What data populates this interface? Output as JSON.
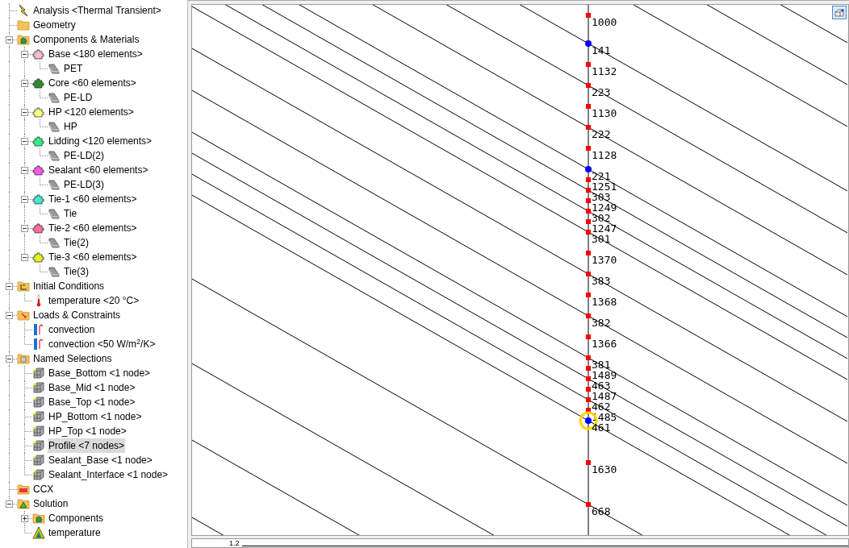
{
  "tree": [
    {
      "label": "Analysis <Thermal Transient>",
      "kind": "analysis",
      "selected": false
    },
    {
      "label": "Geometry",
      "kind": "folder",
      "selected": false
    },
    {
      "label": "Components & Materials",
      "kind": "components",
      "selected": false,
      "expanded": true,
      "children": [
        {
          "label": "Base <180 elements>",
          "kind": "part",
          "color": "#f7bccb",
          "selected": false,
          "expanded": true,
          "children": [
            {
              "label": "PET",
              "kind": "material",
              "selected": false
            }
          ]
        },
        {
          "label": "Core <60 elements>",
          "kind": "part",
          "color": "#2e8b2e",
          "selected": false,
          "expanded": true,
          "children": [
            {
              "label": "PE-LD",
              "kind": "material",
              "selected": false
            }
          ]
        },
        {
          "label": "HP <120 elements>",
          "kind": "part",
          "color": "#ffff88",
          "selected": false,
          "expanded": true,
          "children": [
            {
              "label": "HP",
              "kind": "material",
              "selected": false
            }
          ]
        },
        {
          "label": "Lidding <120 elements>",
          "kind": "part",
          "color": "#33ee88",
          "selected": false,
          "expanded": true,
          "children": [
            {
              "label": "PE-LD(2)",
              "kind": "material",
              "selected": false
            }
          ]
        },
        {
          "label": "Sealant <60 elements>",
          "kind": "part",
          "color": "#ff55ee",
          "selected": false,
          "expanded": true,
          "children": [
            {
              "label": "PE-LD(3)",
              "kind": "material",
              "selected": false
            }
          ]
        },
        {
          "label": "Tie-1 <60 elements>",
          "kind": "part",
          "color": "#44e8d0",
          "selected": false,
          "expanded": true,
          "children": [
            {
              "label": "Tie",
              "kind": "material",
              "selected": false
            }
          ]
        },
        {
          "label": "Tie-2 <60 elements>",
          "kind": "part",
          "color": "#ff6fa0",
          "selected": false,
          "expanded": true,
          "children": [
            {
              "label": "Tie(2)",
              "kind": "material",
              "selected": false
            }
          ]
        },
        {
          "label": "Tie-3 <60 elements>",
          "kind": "part",
          "color": "#e8f020",
          "selected": false,
          "expanded": true,
          "children": [
            {
              "label": "Tie(3)",
              "kind": "material",
              "selected": false
            }
          ]
        }
      ]
    },
    {
      "label": "Initial Conditions",
      "kind": "initial",
      "selected": false,
      "expanded": true,
      "children": [
        {
          "label": "temperature <20 °C>",
          "kind": "thermometer",
          "selected": false
        }
      ]
    },
    {
      "label": "Loads & Constraints",
      "kind": "loads",
      "selected": false,
      "expanded": true,
      "children": [
        {
          "label": "convection",
          "kind": "convection",
          "selected": false
        },
        {
          "label": "convection <50 W/m$^{2}$/K>",
          "kind": "convection",
          "selected": false
        }
      ]
    },
    {
      "label": "Named Selections",
      "kind": "selections",
      "selected": false,
      "expanded": true,
      "children": [
        {
          "label": "Base_Bottom <1 node>",
          "kind": "nodeset",
          "selected": false
        },
        {
          "label": "Base_Mid <1 node>",
          "kind": "nodeset",
          "selected": false
        },
        {
          "label": "Base_Top <1 node>",
          "kind": "nodeset",
          "selected": false
        },
        {
          "label": "HP_Bottom <1 node>",
          "kind": "nodeset",
          "selected": false
        },
        {
          "label": "HP_Top <1 node>",
          "kind": "nodeset",
          "selected": false
        },
        {
          "label": "Profile <7 nodes>",
          "kind": "nodeset",
          "selected": true
        },
        {
          "label": "Sealant_Base <1 node>",
          "kind": "nodeset",
          "selected": false
        },
        {
          "label": "Sealant_Interface <1 node>",
          "kind": "nodeset",
          "selected": false
        }
      ]
    },
    {
      "label": "CCX",
      "kind": "ccx",
      "selected": false
    },
    {
      "label": "Solution",
      "kind": "solution",
      "selected": false,
      "expanded": true,
      "children": [
        {
          "label": "Components",
          "kind": "components",
          "selected": false,
          "expanded": false
        },
        {
          "label": "temperature",
          "kind": "result",
          "selected": false
        }
      ]
    }
  ],
  "viewport": {
    "nodes": [
      {
        "label": "1000",
        "kind": "square",
        "selected": false
      },
      {
        "label": "141",
        "kind": "dot",
        "selected": false
      },
      {
        "label": "1132",
        "kind": "square",
        "selected": false
      },
      {
        "label": "223",
        "kind": "square",
        "selected": false
      },
      {
        "label": "1130",
        "kind": "square",
        "selected": false
      },
      {
        "label": "222",
        "kind": "square",
        "selected": false
      },
      {
        "label": "1128",
        "kind": "square",
        "selected": false
      },
      {
        "label": "221",
        "kind": "dot",
        "selected": false
      },
      {
        "label": "1251",
        "kind": "square",
        "selected": false
      },
      {
        "label": "303",
        "kind": "square",
        "selected": false
      },
      {
        "label": "1249",
        "kind": "square",
        "selected": false
      },
      {
        "label": "302",
        "kind": "square",
        "selected": false
      },
      {
        "label": "1247",
        "kind": "square",
        "selected": false
      },
      {
        "label": "301",
        "kind": "square",
        "selected": false
      },
      {
        "label": "1370",
        "kind": "square",
        "selected": false
      },
      {
        "label": "383",
        "kind": "square",
        "selected": false
      },
      {
        "label": "1368",
        "kind": "square",
        "selected": false
      },
      {
        "label": "382",
        "kind": "square",
        "selected": false
      },
      {
        "label": "1366",
        "kind": "square",
        "selected": false
      },
      {
        "label": "381",
        "kind": "square",
        "selected": false
      },
      {
        "label": "1489",
        "kind": "square",
        "selected": false
      },
      {
        "label": "463",
        "kind": "square",
        "selected": false
      },
      {
        "label": "1487",
        "kind": "square",
        "selected": false
      },
      {
        "label": "462",
        "kind": "square",
        "selected": false
      },
      {
        "label": "1485",
        "kind": "square",
        "selected": false
      },
      {
        "label": "461",
        "kind": "dot",
        "selected": true
      },
      {
        "label": "1630",
        "kind": "square",
        "selected": false
      },
      {
        "label": "668",
        "kind": "square",
        "selected": false
      }
    ]
  },
  "bottom_panel": {
    "axis_label": "1.2"
  }
}
